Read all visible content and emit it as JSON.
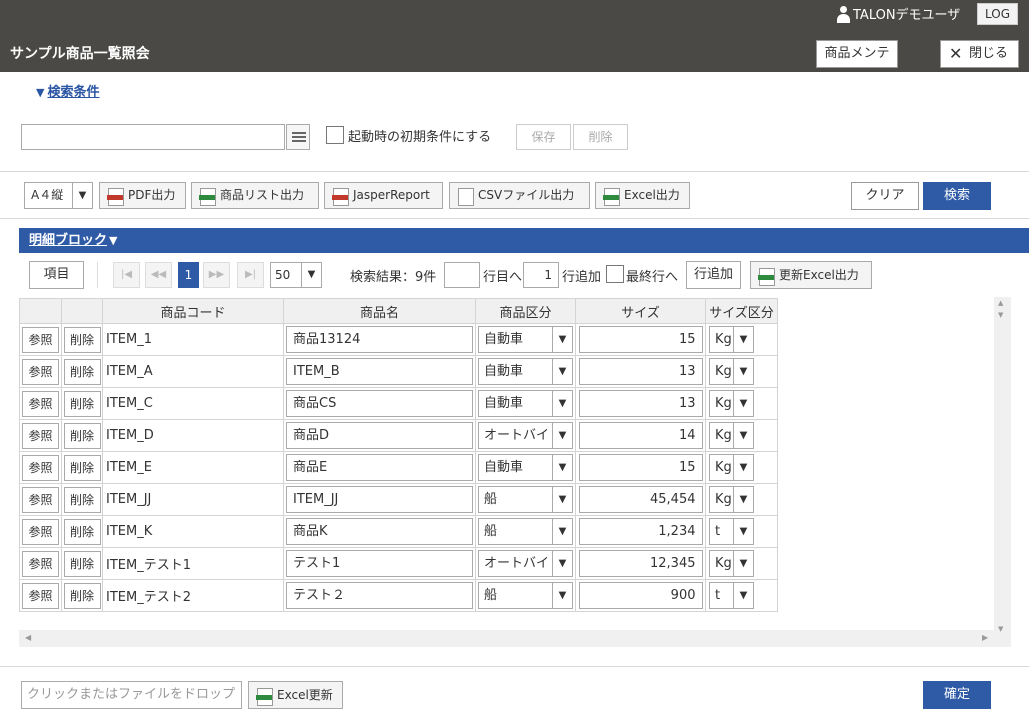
{
  "header": {
    "user_name": "TALONデモユーザ",
    "logout_label": "LOG",
    "title": "サンプル商品一覧照会",
    "maint_label": "商品メンテ",
    "close_label": "閉じる"
  },
  "conditions": {
    "toggle_label": "検索条件",
    "saved_condition": "",
    "init_checkbox_label": "起動時の初期条件にする",
    "init_checked": false,
    "save_label": "保存",
    "delete_label": "削除"
  },
  "toolbar": {
    "paper": "A４縦",
    "pdf_label": "PDF出力",
    "list_label": "商品リスト出力",
    "jasper_label": "JasperReport",
    "csv_label": "CSVファイル出力",
    "excel_label": "Excel出力",
    "clear_label": "クリア",
    "search_label": "検索"
  },
  "detail": {
    "block_label": "明細ブロック",
    "item_label": "項目",
    "current_page": "1",
    "rows_per_page": "50",
    "result_text": "検索結果：9件",
    "goto_row_value": "",
    "goto_row_label": "行目へ",
    "add_count": "1",
    "add_label": "行追加",
    "last_row_label": "最終行へ",
    "last_row_checked": false,
    "add_row_button": "行追加",
    "excel_update_out_label": "更新Excel出力"
  },
  "table": {
    "headers": [
      "",
      "",
      "商品コード",
      "商品名",
      "商品区分",
      "サイズ",
      "サイズ区分"
    ],
    "ref_label": "参照",
    "del_label": "削除",
    "rows": [
      {
        "code": "ITEM_1",
        "name": "商品13124",
        "category": "自動車",
        "size": "15",
        "unit": "Kg"
      },
      {
        "code": "ITEM_A",
        "name": "ITEM_B",
        "category": "自動車",
        "size": "13",
        "unit": "Kg"
      },
      {
        "code": "ITEM_C",
        "name": "商品CS",
        "category": "自動車",
        "size": "13",
        "unit": "Kg"
      },
      {
        "code": "ITEM_D",
        "name": "商品D",
        "category": "オートバイ",
        "size": "14",
        "unit": "Kg"
      },
      {
        "code": "ITEM_E",
        "name": "商品E",
        "category": "自動車",
        "size": "15",
        "unit": "Kg"
      },
      {
        "code": "ITEM_JJ",
        "name": "ITEM_JJ",
        "category": "船",
        "size": "45,454",
        "unit": "Kg"
      },
      {
        "code": "ITEM_K",
        "name": "商品K",
        "category": "船",
        "size": "1,234",
        "unit": "t"
      },
      {
        "code": "ITEM_テスト1",
        "name": "テスト1",
        "category": "オートバイ",
        "size": "12,345",
        "unit": "Kg"
      },
      {
        "code": "ITEM_テスト2",
        "name": "テスト２",
        "category": "船",
        "size": "900",
        "unit": "t"
      }
    ]
  },
  "footer": {
    "drop_placeholder": "クリックまたはファイルをドロップ",
    "excel_update_label": "Excel更新",
    "confirm_label": "確定"
  },
  "colors": {
    "header_bg": "#4a4945",
    "accent": "#2e5aa6",
    "pdf_icon": "#c0392b",
    "excel_icon": "#2e8b3e"
  }
}
